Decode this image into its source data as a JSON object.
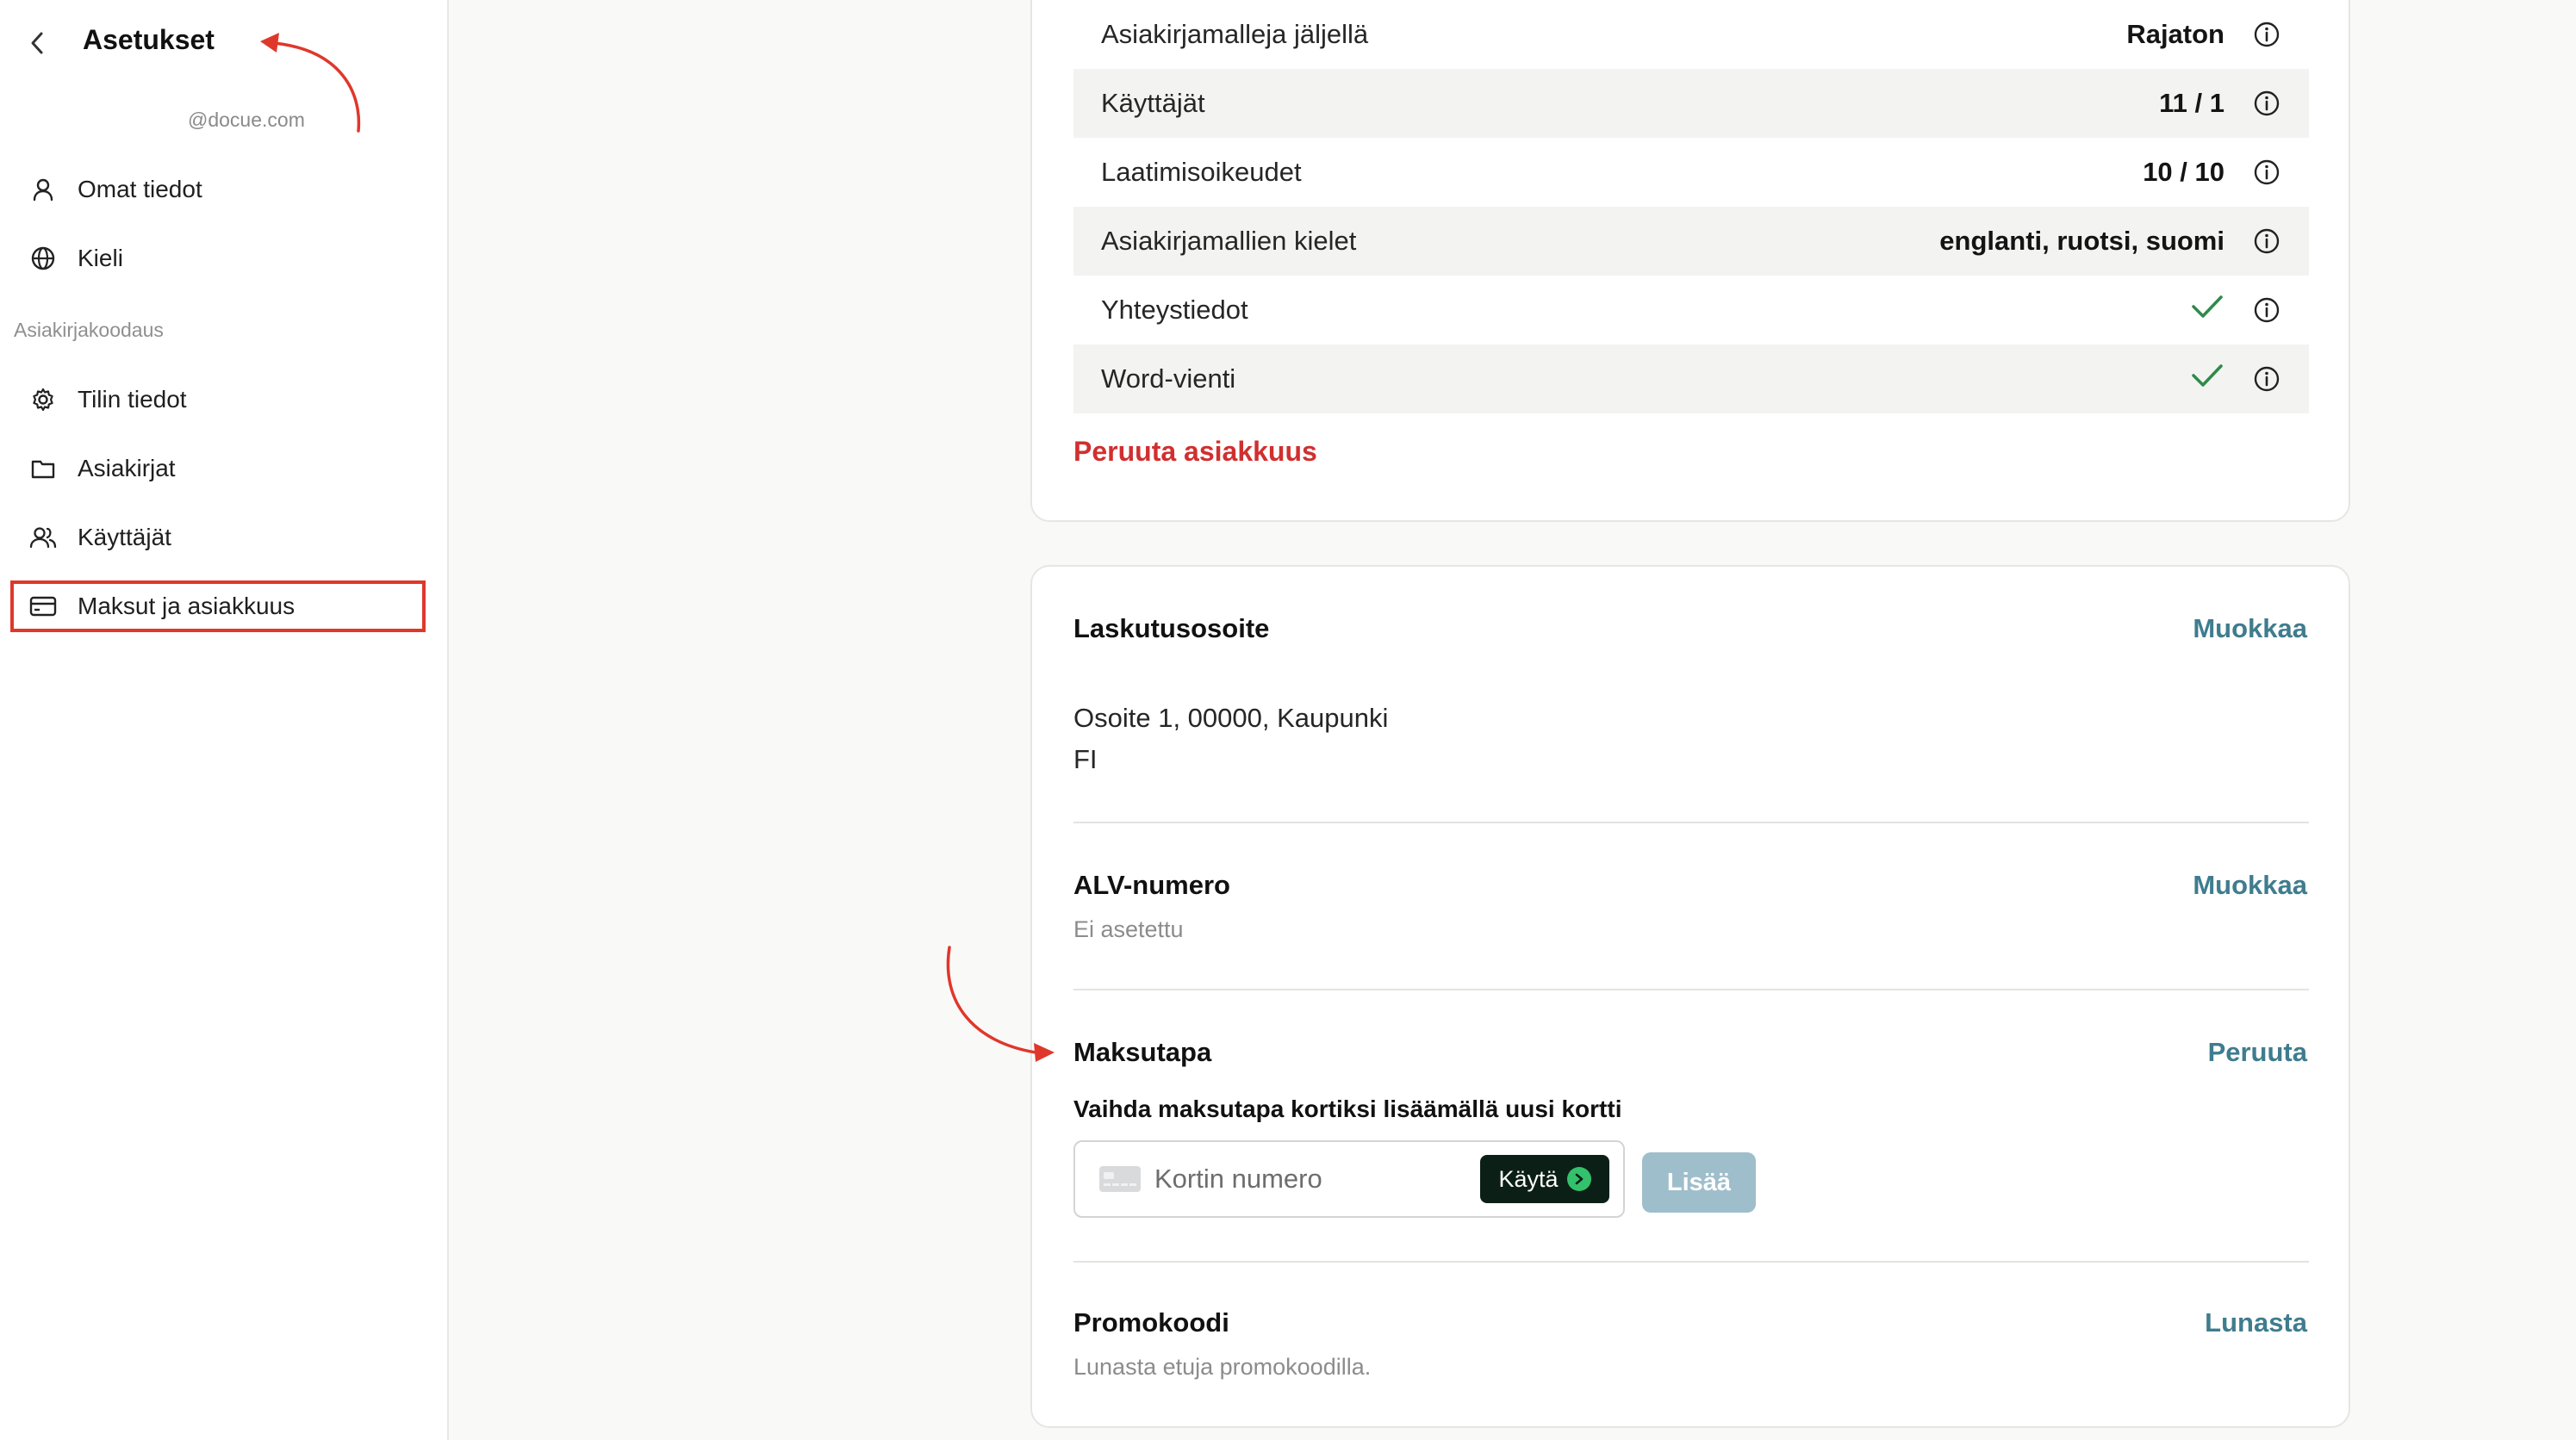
{
  "sidebar": {
    "title": "Asetukset",
    "account_domain": "@docue.com",
    "personal_items": [
      {
        "label": "Omat tiedot",
        "icon": "user-icon"
      },
      {
        "label": "Kieli",
        "icon": "globe-icon"
      }
    ],
    "section_label": "Asiakirjakoodaus",
    "org_items": [
      {
        "label": "Tilin tiedot",
        "icon": "gear-icon"
      },
      {
        "label": "Asiakirjat",
        "icon": "folder-icon"
      },
      {
        "label": "Käyttäjät",
        "icon": "users-icon"
      },
      {
        "label": "Maksut ja asiakkuus",
        "icon": "credit-card-icon",
        "active": true
      }
    ]
  },
  "plan": {
    "rows": [
      {
        "label": "Asiakirjamalleja jäljellä",
        "value": "Rajaton"
      },
      {
        "label": "Käyttäjät",
        "value": "11 / 1"
      },
      {
        "label": "Laatimisoikeudet",
        "value": "10 / 10"
      },
      {
        "label": "Asiakirjamallien kielet",
        "value": "englanti, ruotsi, suomi"
      },
      {
        "label": "Yhteystiedot",
        "value": "check"
      },
      {
        "label": "Word-vienti",
        "value": "check"
      }
    ],
    "cancel_label": "Peruuta asiakkuus"
  },
  "billing": {
    "address_title": "Laskutusosoite",
    "address_edit": "Muokkaa",
    "address_line1": "Osoite 1, 00000, Kaupunki",
    "address_line2": "FI",
    "vat_title": "ALV-numero",
    "vat_edit": "Muokkaa",
    "vat_value": "Ei asetettu",
    "payment_title": "Maksutapa",
    "payment_cancel": "Peruuta",
    "payment_hint": "Vaihda maksutapa kortiksi lisäämällä uusi kortti",
    "card_placeholder": "Kortin numero",
    "use_button": "Käytä",
    "add_button": "Lisää",
    "promo_title": "Promokoodi",
    "promo_action": "Lunasta",
    "promo_desc": "Lunasta etuja promokoodilla."
  },
  "colors": {
    "accent": "#3f7c8e",
    "danger": "#d12f2f",
    "check": "#2f8a4a",
    "annotation": "#e0372b"
  }
}
